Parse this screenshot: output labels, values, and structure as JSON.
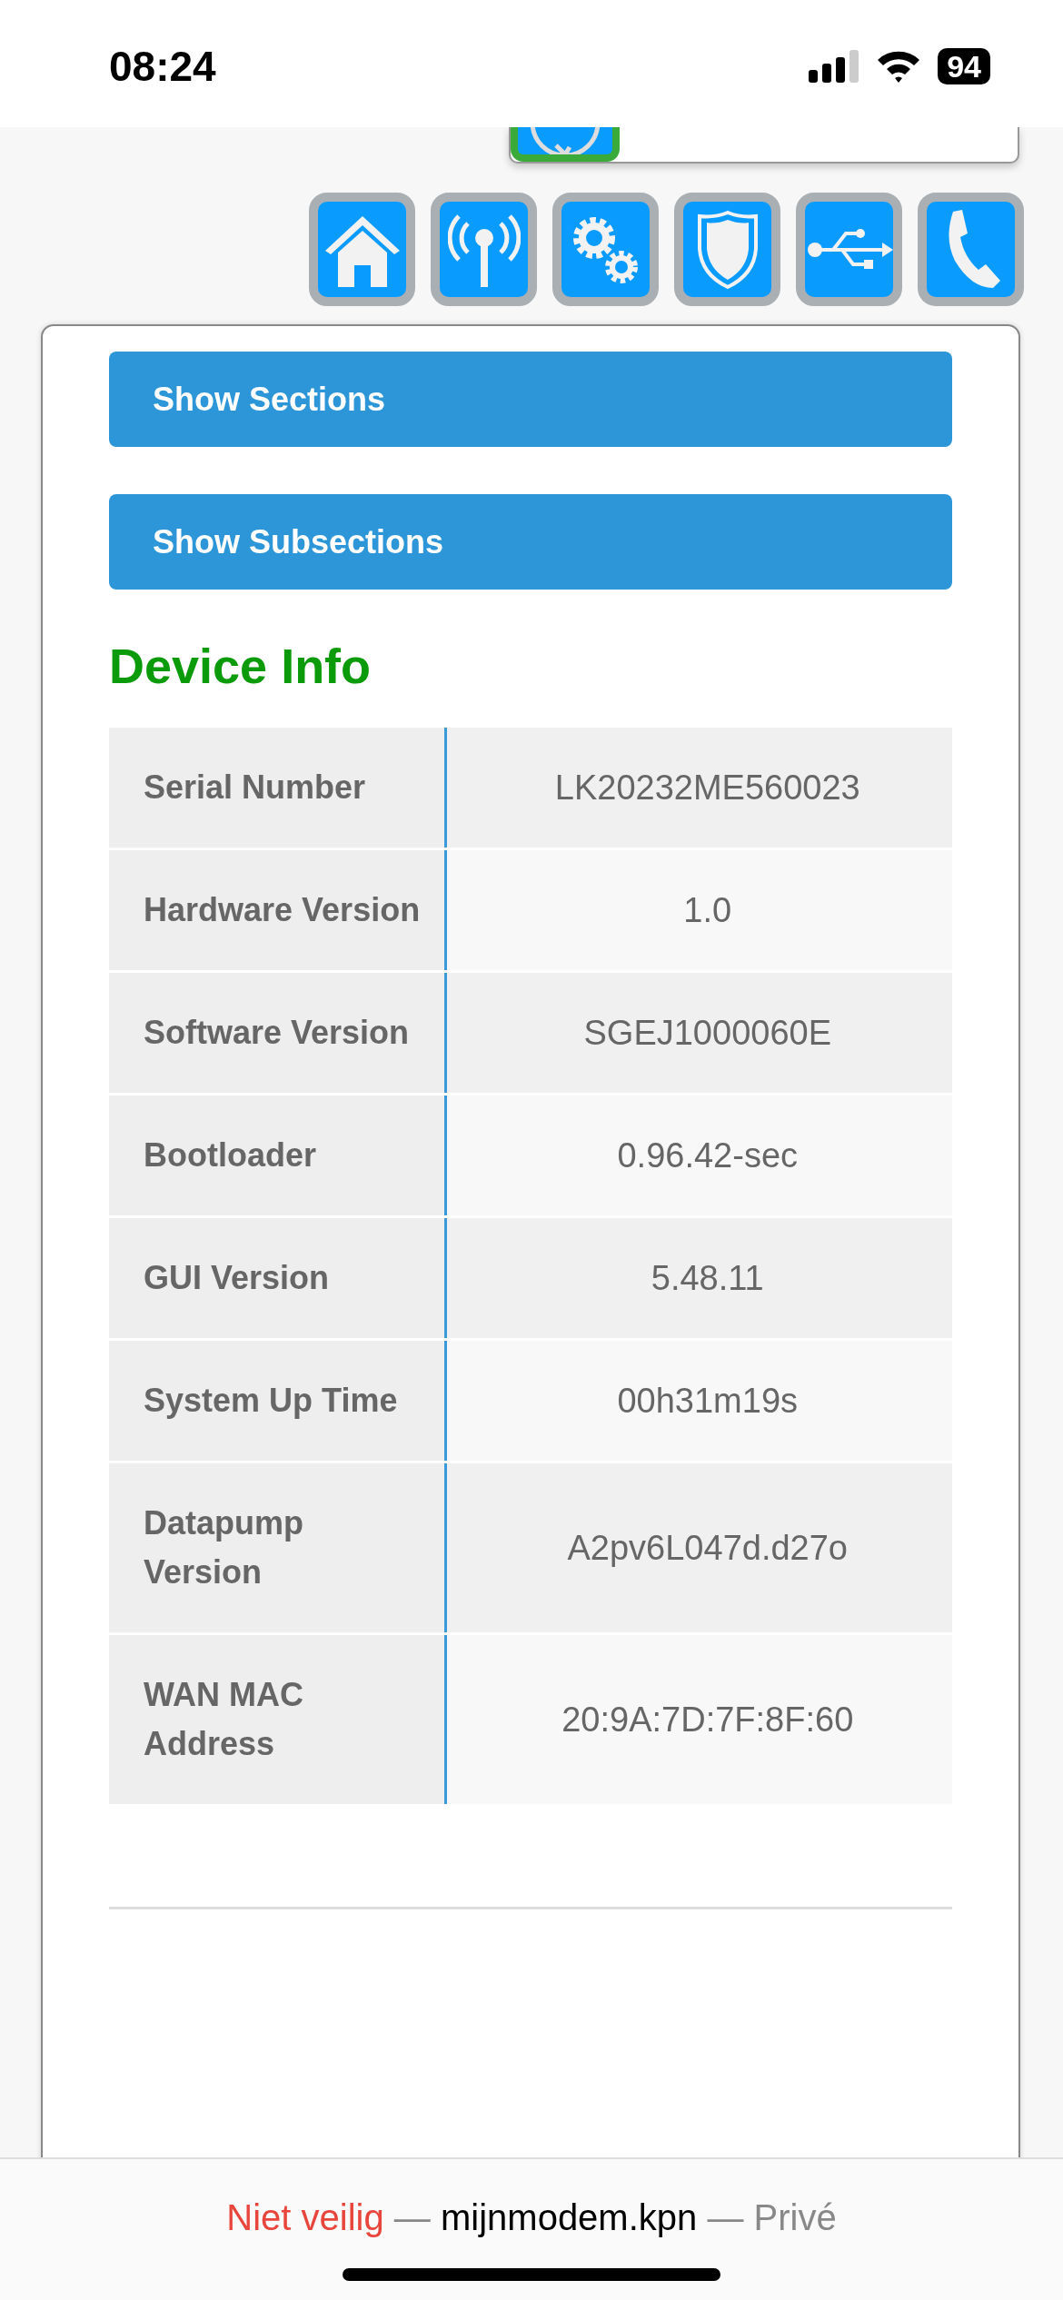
{
  "status_bar": {
    "time": "08:24",
    "battery": "94"
  },
  "nav_icons": [
    {
      "kind": "home"
    },
    {
      "kind": "antenna"
    },
    {
      "kind": "gears"
    },
    {
      "kind": "shield"
    },
    {
      "kind": "usb"
    },
    {
      "kind": "phone"
    }
  ],
  "buttons": [
    "Show Sections",
    "Show Subsections"
  ],
  "heading": "Device Info",
  "device_info": [
    {
      "label": "Serial Number",
      "value": "LK20232ME560023"
    },
    {
      "label": "Hardware Version",
      "value": "1.0"
    },
    {
      "label": "Software Version",
      "value": "SGEJ1000060E"
    },
    {
      "label": "Bootloader",
      "value": "0.96.42-sec"
    },
    {
      "label": "GUI Version",
      "value": "5.48.11"
    },
    {
      "label": "System Up Time",
      "value": "00h31m19s"
    },
    {
      "label": "Datapump Version",
      "value": "A2pv6L047d.d27o"
    },
    {
      "label": "WAN MAC Address",
      "value": "20:9A:7D:7F:8F:60"
    }
  ],
  "address_bar": {
    "security": "Niet veilig",
    "separator": "—",
    "domain": "mijnmodem.kpn",
    "mode": "Privé"
  }
}
